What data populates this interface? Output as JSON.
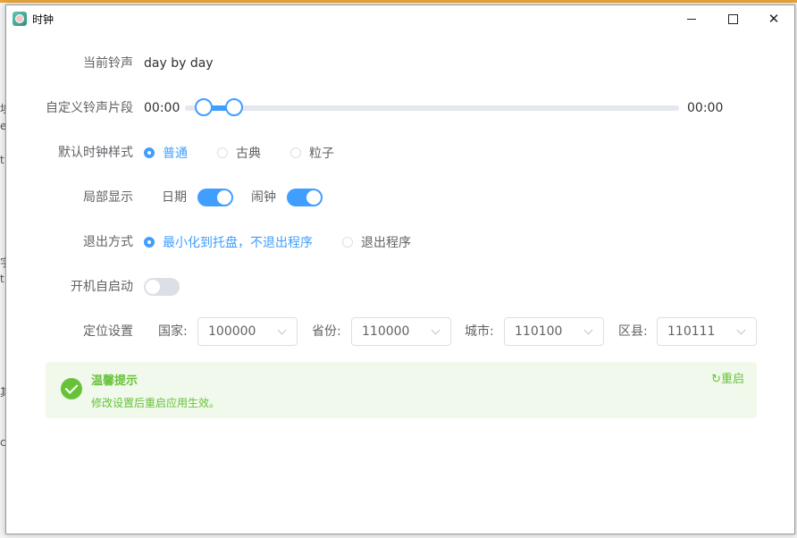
{
  "window": {
    "title": "时钟"
  },
  "background_fragments": [
    "埃",
    "e",
    "t",
    "字",
    "t",
    "其",
    "c"
  ],
  "form": {
    "ringtone": {
      "label": "当前铃声",
      "value": "day by day"
    },
    "segment": {
      "label": "自定义铃声片段",
      "start": "00:00",
      "end": "00:00",
      "range": [
        0.04,
        0.1
      ]
    },
    "style": {
      "label": "默认时钟样式",
      "options": [
        "普通",
        "古典",
        "粒子"
      ],
      "selected": "普通"
    },
    "display": {
      "label": "局部显示",
      "date_label": "日期",
      "date_on": true,
      "alarm_label": "闹钟",
      "alarm_on": true
    },
    "exit": {
      "label": "退出方式",
      "options": [
        "最小化到托盘，不退出程序",
        "退出程序"
      ],
      "selected": "最小化到托盘，不退出程序"
    },
    "autostart": {
      "label": "开机自启动",
      "on": false
    },
    "location": {
      "label": "定位设置",
      "country_label": "国家:",
      "country": "100000",
      "province_label": "省份:",
      "province": "110000",
      "city_label": "城市:",
      "city": "110100",
      "district_label": "区县:",
      "district": "110111"
    }
  },
  "alert": {
    "title": "温馨提示",
    "description": "修改设置后重启应用生效。",
    "action": "重启",
    "action_icon": "refresh-icon"
  },
  "colors": {
    "primary": "#409eff",
    "success": "#67c23a",
    "success_bg": "#f0f9eb"
  }
}
